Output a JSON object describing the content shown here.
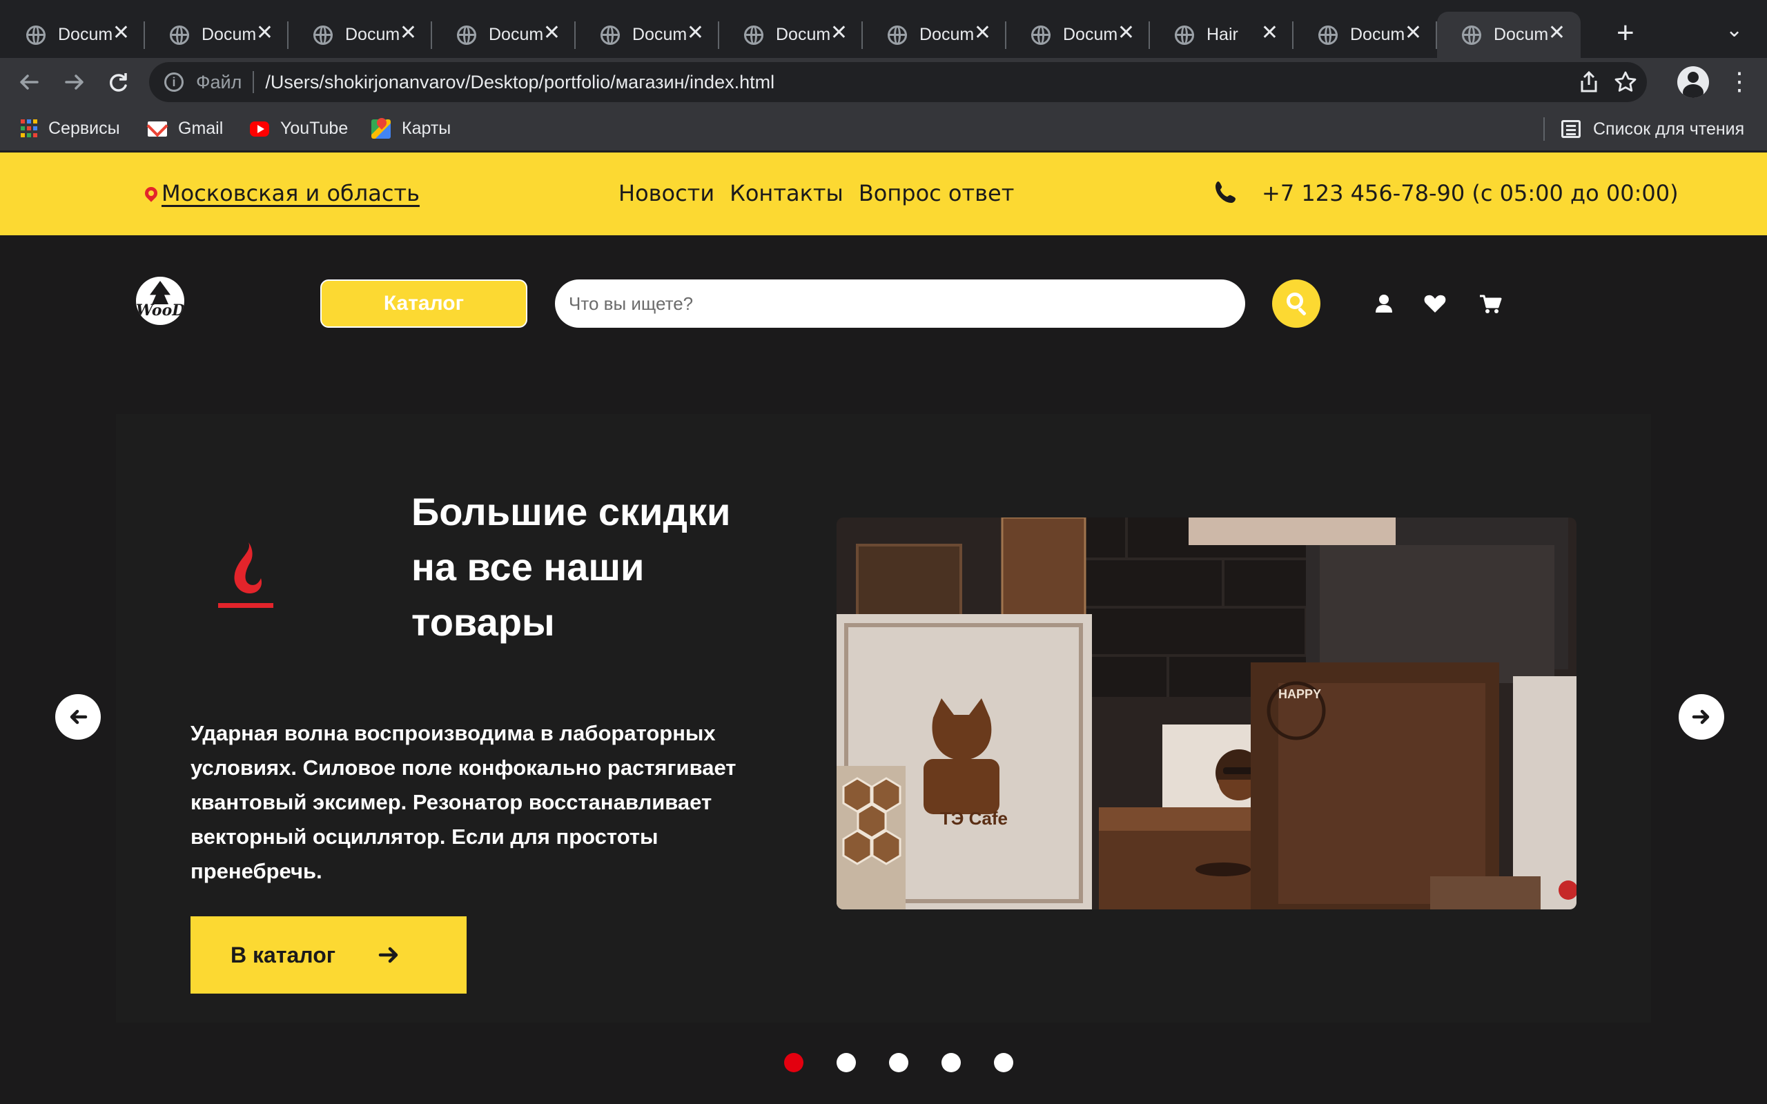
{
  "browser": {
    "tabs": [
      {
        "title": "Docum"
      },
      {
        "title": "Docum"
      },
      {
        "title": "Docum"
      },
      {
        "title": "Docum"
      },
      {
        "title": "Docum"
      },
      {
        "title": "Docum"
      },
      {
        "title": "Docum"
      },
      {
        "title": "Docum"
      },
      {
        "title": "Hair"
      },
      {
        "title": "Docum"
      },
      {
        "title": "Docum",
        "active": true
      }
    ],
    "close_glyph": "✕",
    "new_tab_glyph": "+",
    "scheme_label": "Файл",
    "url": "/Users/shokirjonanvarov/Desktop/portfolio/магазин/index.html",
    "bookmarks": [
      {
        "label": "Сервисы",
        "icon": "apps-grid-icon"
      },
      {
        "label": "Gmail",
        "icon": "gmail-icon"
      },
      {
        "label": "YouTube",
        "icon": "youtube-icon"
      },
      {
        "label": "Карты",
        "icon": "maps-icon"
      }
    ],
    "reading_list": "Список для чтения"
  },
  "topbar": {
    "region": "Московская и область",
    "nav": [
      "Новости",
      "Контакты",
      "Вопрос ответ"
    ],
    "phone": "+7 123 456-78-90 (с 05:00 до 00:00)"
  },
  "header": {
    "logo_text": "WooD",
    "catalog_label": "Каталог",
    "search_placeholder": "Что вы ищете?",
    "icons": [
      "search-icon",
      "user-icon",
      "heart-icon",
      "cart-icon"
    ]
  },
  "hero": {
    "title": "Большие скидки на все наши товары",
    "description": "Ударная волна воспроизводима в лабораторных условиях. Силовое поле конфокально растягивает квантовый эксимер. Резонатор восстанавливает векторный осциллятор. Если для простоты пренебречь.",
    "cta_label": "В каталог",
    "image_labels": [
      "ТЭ Cafe",
      "HAPPY"
    ],
    "slides_count": 5,
    "active_slide": 0
  },
  "colors": {
    "accent": "#fcd932",
    "background": "#1b1a1b",
    "hero_bg": "#1d1d1d",
    "dot_active": "#e3000f",
    "flame": "#e3242b"
  }
}
